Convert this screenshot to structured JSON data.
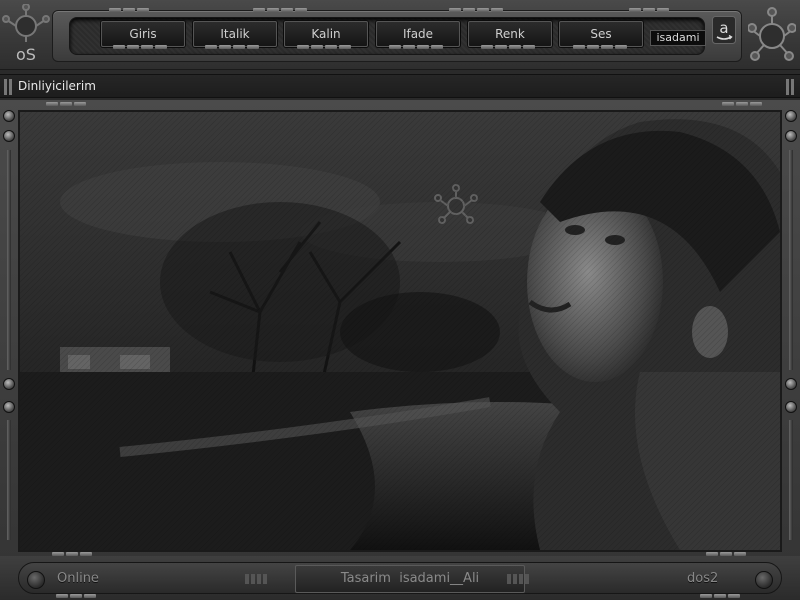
{
  "header": {
    "menu": [
      {
        "label": "Giris"
      },
      {
        "label": "Italik"
      },
      {
        "label": "Kalin"
      },
      {
        "label": "Ifade"
      },
      {
        "label": "Renk"
      },
      {
        "label": "Ses"
      }
    ],
    "brand": "isadami",
    "amazon_glyph": "a",
    "logo_text": "oS"
  },
  "title": "Dinliyicilerim",
  "footer": {
    "left": "Online",
    "center": "Tasarim  isadami__Ali",
    "right": "dos2"
  },
  "colors": {
    "chrome": "#3a3a3a",
    "panel": "#1e1e1e",
    "text": "#cfcfcf"
  }
}
